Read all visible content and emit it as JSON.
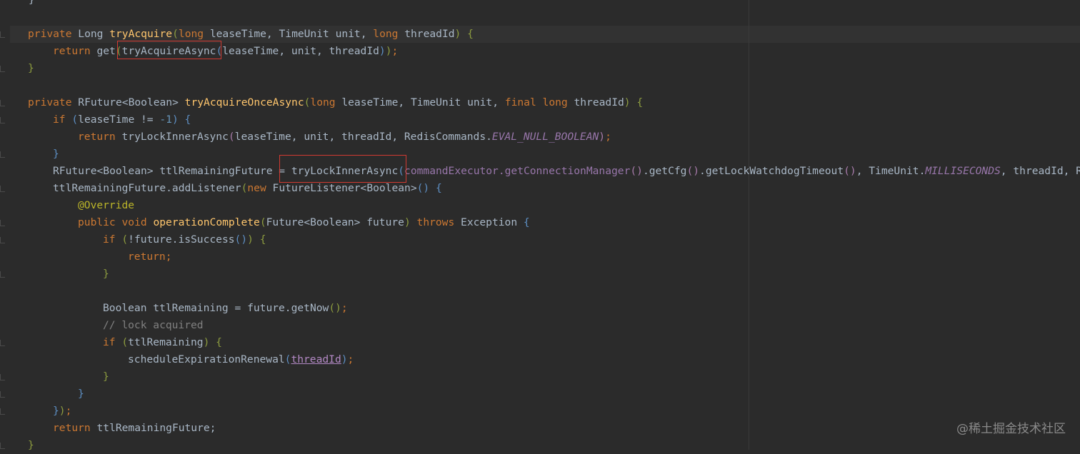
{
  "code": {
    "l0": "}",
    "l1_kw": "private",
    "l1_type": " Long ",
    "l1_fn": "tryAcquire",
    "l1_p1": "(",
    "l1_long1": "long",
    "l1_a": " leaseTime, TimeUnit unit, ",
    "l1_long2": "long",
    "l1_b": " threadId",
    "l1_p2": ")",
    "l1_brace": " {",
    "l2_kw": "return",
    "l2_a": " get",
    "l2_p1": "(",
    "l2_b": "tryAcquireAsync",
    "l2_p2": "(",
    "l2_c": "leaseTime, unit, threadId",
    "l2_p3": ")",
    "l2_p4": ")",
    "l2_end": ";",
    "l3": "}",
    "l5_kw": "private",
    "l5_type": " RFuture<Boolean> ",
    "l5_fn": "tryAcquireOnceAsync",
    "l5_p1": "(",
    "l5_long1": "long",
    "l5_a": " leaseTime, TimeUnit unit, ",
    "l5_final": "final",
    "l5_sp": " ",
    "l5_long2": "long",
    "l5_b": " threadId",
    "l5_p2": ")",
    "l5_brace": " {",
    "l6_kw": "if",
    "l6_p1": " (",
    "l6_a": "leaseTime != ",
    "l6_num": "-1",
    "l6_p2": ")",
    "l6_brace": " {",
    "l7_kw": "return",
    "l7_a": " tryLockInnerAsync",
    "l7_p1": "(",
    "l7_b": "leaseTime, unit, threadId, RedisCommands.",
    "l7_const": "EVAL_NULL_BOOLEAN",
    "l7_p2": ")",
    "l7_end": ";",
    "l8": "}",
    "l9_a": "RFuture<Boolean> ttlRemainingFuture = tryLockInnerAsync",
    "l9_p1": "(",
    "l9_b": "commandExecutor.getConnectionManager",
    "l9_p2": "()",
    "l9_c": ".getCfg",
    "l9_p3": "()",
    "l9_d": ".getLockWatchdogTimeout",
    "l9_p4": "()",
    "l9_e": ", TimeUnit.",
    "l9_const": "MILLISECONDS",
    "l9_f": ", threadId, Re",
    "l10_a": "ttlRemainingFuture.addListener",
    "l10_p1": "(",
    "l10_new": "new",
    "l10_b": " FutureListener<Boolean>",
    "l10_p2": "()",
    "l10_brace": " {",
    "l11_ann": "@Override",
    "l12_kw1": "public",
    "l12_sp": " ",
    "l12_kw2": "void",
    "l12_sp2": " ",
    "l12_fn": "operationComplete",
    "l12_p1": "(",
    "l12_a": "Future<Boolean> future",
    "l12_p2": ")",
    "l12_sp3": " ",
    "l12_throws": "throws",
    "l12_b": " Exception",
    "l12_brace": " {",
    "l13_kw": "if",
    "l13_p1": " (",
    "l13_a": "!future.isSuccess",
    "l13_p2": "()",
    "l13_p3": ")",
    "l13_brace": " {",
    "l14_kw": "return",
    "l14_end": ";",
    "l15": "}",
    "l17_a": "Boolean ttlRemaining = future.getNow",
    "l17_p": "()",
    "l17_end": ";",
    "l18": "// lock acquired",
    "l19_kw": "if",
    "l19_p1": " (",
    "l19_a": "ttlRemaining",
    "l19_p2": ")",
    "l19_brace": " {",
    "l20_a": "scheduleExpirationRenewal",
    "l20_p1": "(",
    "l20_link": "threadId",
    "l20_p2": ")",
    "l20_end": ";",
    "l21": "}",
    "l22": "}",
    "l23_a": "}",
    "l23_p": ")",
    "l23_end": ";",
    "l24_kw": "return",
    "l24_a": " ttlRemainingFuture;",
    "l25": "}"
  },
  "watermark": "@稀土掘金技术社区"
}
